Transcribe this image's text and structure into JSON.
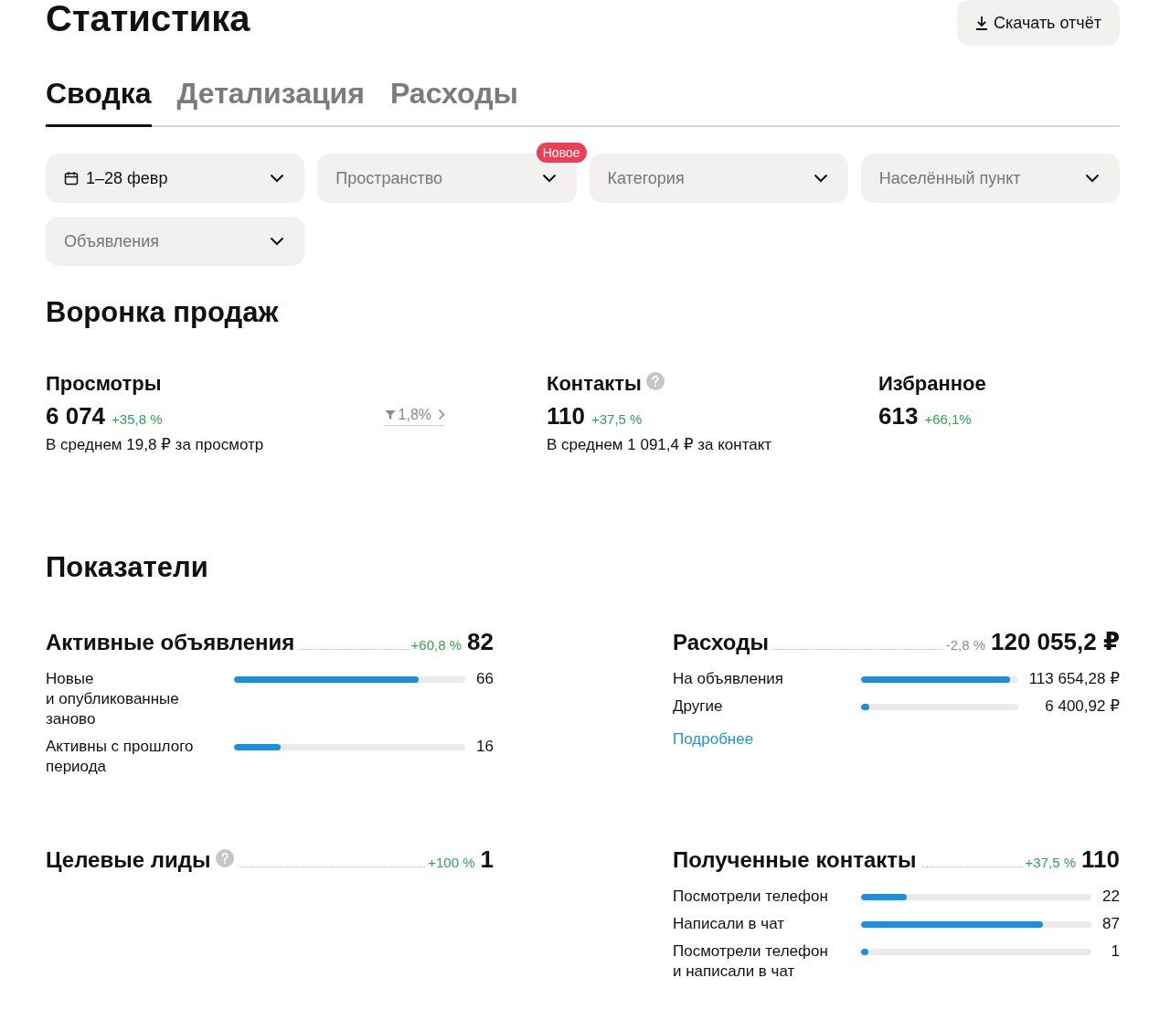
{
  "header": {
    "title": "Статистика",
    "download_button": "Скачать отчёт"
  },
  "tabs": [
    {
      "label": "Сводка",
      "selected": true
    },
    {
      "label": "Детализация",
      "selected": false
    },
    {
      "label": "Расходы",
      "selected": false
    }
  ],
  "filters": [
    {
      "kind": "date",
      "value": "1–28 февр"
    },
    {
      "kind": "select",
      "placeholder": "Пространство",
      "badge": "Новое"
    },
    {
      "kind": "select",
      "placeholder": "Категория"
    },
    {
      "kind": "select",
      "placeholder": "Населённый пункт"
    },
    {
      "kind": "select",
      "placeholder": "Объявления"
    }
  ],
  "funnel": {
    "title": "Воронка продаж",
    "items": [
      {
        "title": "Просмотры",
        "help": false,
        "value": "6 074",
        "delta": "+35,8 %",
        "color": "#2ea552",
        "note": "В среднем 19,8 ₽ за просмотр",
        "conversion": "1,8%"
      },
      {
        "title": "Контакты",
        "help": true,
        "value": "110",
        "delta": "+37,5 %",
        "color": "#2ea552",
        "note": "В среднем 1 091,4 ₽ за контакт"
      },
      {
        "title": "Избранное",
        "help": false,
        "value": "613",
        "delta": "+66,1%",
        "color": "#2ea552"
      }
    ]
  },
  "indicators": {
    "title": "Показатели",
    "metrics": [
      {
        "title": "Активные объявления",
        "help": false,
        "delta": "+60,8 %",
        "color": "#2ea552",
        "value": "82",
        "rows": [
          {
            "label": "Новые\nи опубликованные\nзаново",
            "level": 0.8,
            "value": "66"
          },
          {
            "label": "Активны с прошлого\nпериода",
            "level": 0.2,
            "value": "16"
          }
        ]
      },
      {
        "title": "Расходы",
        "help": false,
        "delta": "-2,8 %",
        "color": "#8c8c8c",
        "value": "120 055,2 ₽",
        "rows": [
          {
            "label": "На объявления",
            "level": 0.95,
            "value": "113 654,28 ₽"
          },
          {
            "label": "Другие",
            "level": 0.05,
            "value": "6 400,92 ₽"
          }
        ],
        "link": "Подробнее"
      },
      {
        "title": "Целевые лиды",
        "help": true,
        "delta": "+100 %",
        "color": "#2ea552",
        "value": "1"
      },
      {
        "title": "Полученные контакты",
        "help": false,
        "delta": "+37,5 %",
        "color": "#2ea552",
        "value": "110",
        "rows": [
          {
            "label": "Посмотрели телефон",
            "level": 0.2,
            "value": "22"
          },
          {
            "label": "Написали в чат",
            "level": 0.79,
            "value": "87"
          },
          {
            "label": "Посмотрели телефон\nи написали в чат",
            "level": 0.03,
            "value": "1"
          }
        ]
      }
    ]
  }
}
